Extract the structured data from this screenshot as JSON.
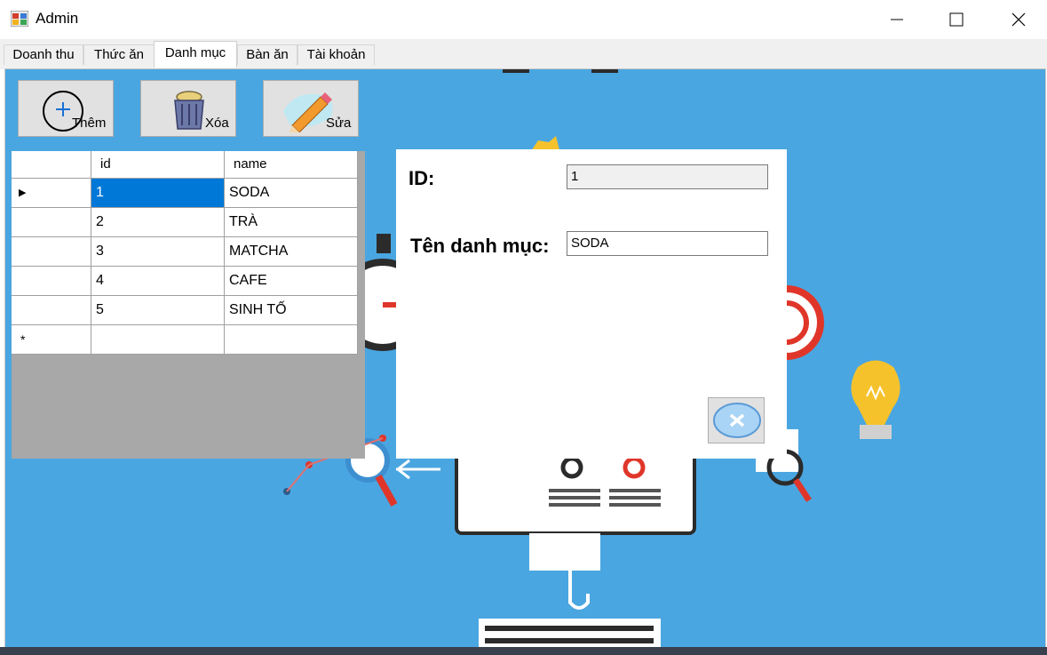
{
  "window": {
    "title": "Admin",
    "icon": "winforms-app-icon",
    "controls": [
      "minimize-icon",
      "maximize-icon",
      "close-icon"
    ]
  },
  "tabs": [
    {
      "label": "Doanh thu",
      "active": false
    },
    {
      "label": "Thức ăn",
      "active": false
    },
    {
      "label": "Danh mục",
      "active": true
    },
    {
      "label": "Bàn ăn",
      "active": false
    },
    {
      "label": "Tài khoản",
      "active": false
    }
  ],
  "toolbar": {
    "add_label": "Thêm",
    "add_icon": "plus-circle-icon",
    "delete_label": "Xóa",
    "delete_icon": "trash-can-icon",
    "edit_label": "Sửa",
    "edit_icon": "pencil-icon"
  },
  "grid": {
    "columns": [
      "id",
      "name"
    ],
    "rows": [
      {
        "id": "1",
        "name": "SODA"
      },
      {
        "id": "2",
        "name": "TRÀ"
      },
      {
        "id": "3",
        "name": "MATCHA"
      },
      {
        "id": "4",
        "name": "CAFE"
      },
      {
        "id": "5",
        "name": "SINH TỐ"
      }
    ],
    "selected_row": 0,
    "current_row_marker": "▶",
    "new_row_marker": "*"
  },
  "detail": {
    "id_label": "ID:",
    "id_value": "1",
    "name_label": "Tên danh mục:",
    "name_value": "SODA",
    "cancel_icon": "close-circle-icon"
  },
  "colors": {
    "background": "#4aa6e0",
    "selection": "#0078d7"
  }
}
